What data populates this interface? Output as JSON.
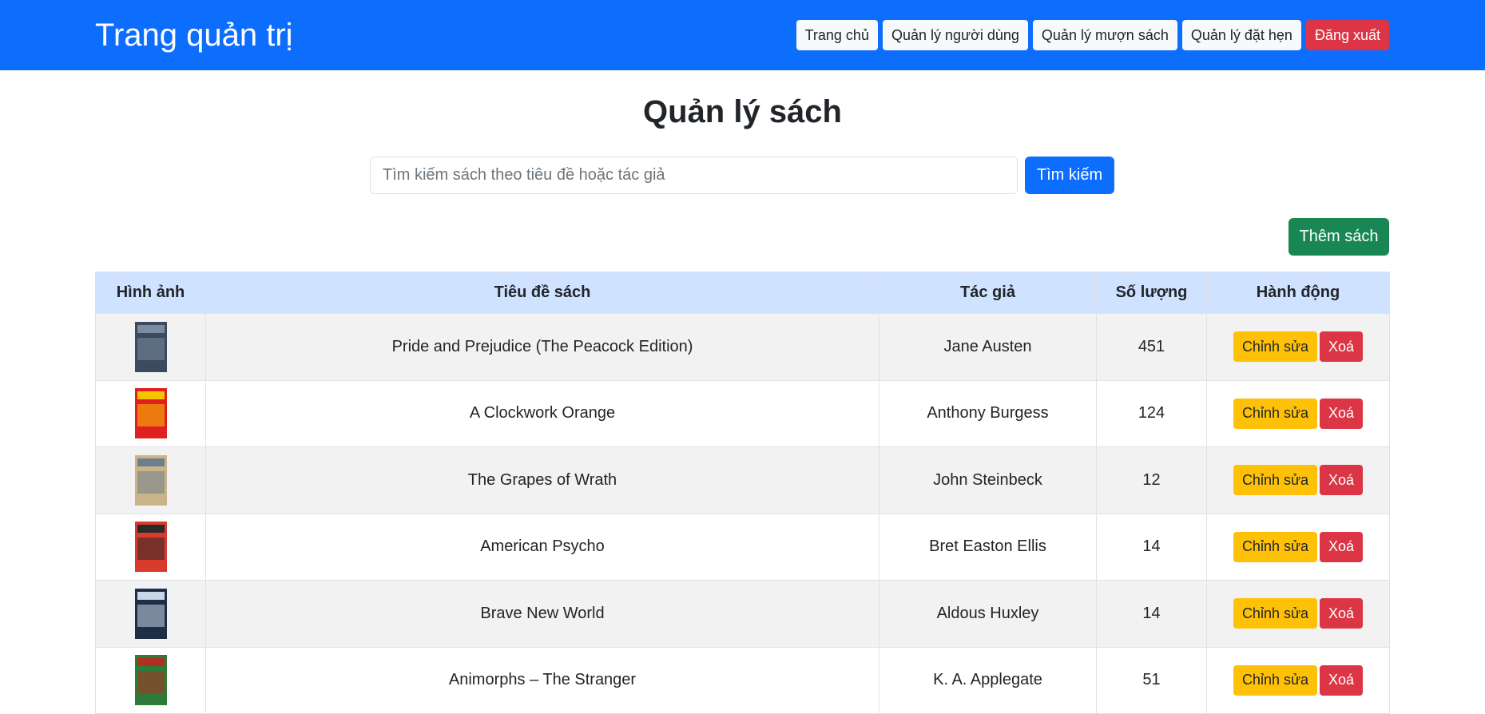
{
  "navbar": {
    "brand": "Trang quản trị",
    "links": [
      "Trang chủ",
      "Quản lý người dùng",
      "Quản lý mượn sách",
      "Quản lý đặt hẹn"
    ],
    "logout": "Đăng xuất"
  },
  "page": {
    "title": "Quản lý sách",
    "search_placeholder": "Tìm kiếm sách theo tiêu đề hoặc tác giả",
    "search_button": "Tìm kiếm",
    "add_button": "Thêm sách"
  },
  "table": {
    "headers": [
      "Hình ảnh",
      "Tiêu đề sách",
      "Tác giả",
      "Số lượng",
      "Hành động"
    ],
    "edit_label": "Chỉnh sửa",
    "delete_label": "Xoá",
    "rows": [
      {
        "title": "Pride and Prejudice (The Peacock Edition)",
        "author": "Jane Austen",
        "quantity": "451",
        "cover_colors": [
          "#3b4a5e",
          "#7a8ca0"
        ]
      },
      {
        "title": "A Clockwork Orange",
        "author": "Anthony Burgess",
        "quantity": "124",
        "cover_colors": [
          "#e02020",
          "#f5c400"
        ]
      },
      {
        "title": "The Grapes of Wrath",
        "author": "John Steinbeck",
        "quantity": "12",
        "cover_colors": [
          "#c9b48a",
          "#6d7f8c"
        ]
      },
      {
        "title": "American Psycho",
        "author": "Bret Easton Ellis",
        "quantity": "14",
        "cover_colors": [
          "#d83a2c",
          "#2a2a2a"
        ]
      },
      {
        "title": "Brave New World",
        "author": "Aldous Huxley",
        "quantity": "14",
        "cover_colors": [
          "#1d2e45",
          "#c9d6e6"
        ]
      },
      {
        "title": "Animorphs – The Stranger",
        "author": "K. A. Applegate",
        "quantity": "51",
        "cover_colors": [
          "#2d7a3a",
          "#b03020"
        ]
      }
    ]
  },
  "colors": {
    "primary": "#0d6efd",
    "success": "#198754",
    "warning": "#ffc107",
    "danger": "#dc3545",
    "table_header": "#cfe2ff"
  }
}
